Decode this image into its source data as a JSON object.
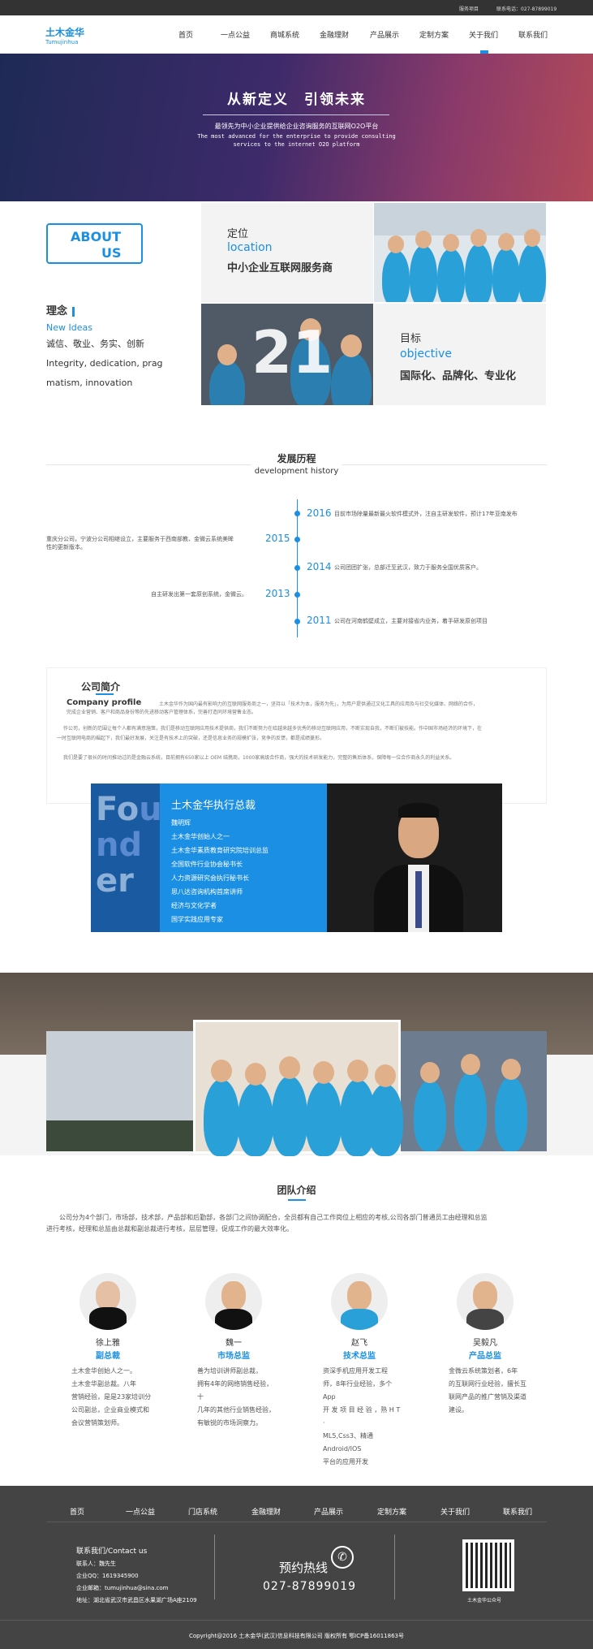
{
  "topbar": {
    "service": "服务项目",
    "phone": "联系电话：027-87899019"
  },
  "brand": {
    "name_cn": "土木金华",
    "name_en": "Tumujinhua"
  },
  "nav": [
    "首页",
    "一点公益",
    "商城系统",
    "金融理财",
    "产品展示",
    "定制方案",
    "关于我们",
    "联系我们"
  ],
  "banner": {
    "title": "从新定义　引领未来",
    "subtitle": "最领先为中小企业提供给企业咨询服务的互联网O2O平台",
    "en_line1": "The most advanced for the enterprise to provide consulting",
    "en_line2": "services to the internet O2O platform"
  },
  "about": {
    "box1": "ABOUT",
    "box2": "US",
    "idea_title": "理念",
    "idea_en": "New Ideas",
    "idea_cn": "诚信、敬业、务实、创新",
    "idea_en1": "Integrity, dedication, prag",
    "idea_en2": "matism, innovation",
    "position_cn": "定位",
    "position_en": "location",
    "position_desc": "中小企业互联网服务商",
    "goal_cn": "目标",
    "goal_en": "objective",
    "goal_desc": "国际化、品牌化、专业化",
    "big_number": "21"
  },
  "history": {
    "title_cn": "发展历程",
    "title_en": "development history",
    "items": [
      {
        "year": "2016",
        "text": "目前市场除量最新最火软件模式外，注自主研发软件，预计17年亚南发布"
      },
      {
        "year": "2015",
        "text1": "重庆分公司，宁波分公司相继设立，主要服务于西南部教、金微云系统美眸",
        "text2": "性的更新版本。"
      },
      {
        "year": "2014",
        "text": "公司团团扩张，总部迁至武汉，致力于服务全国优质客户。"
      },
      {
        "year": "2013",
        "text": "自主研发出第一套原创系统，金微云。"
      },
      {
        "year": "2011",
        "text": "公司在河南鹤壁成立，主要对接省内业务，着手研发原创项目"
      }
    ]
  },
  "company": {
    "title_cn": "公司简介",
    "title_en": "Company profile",
    "p1a": "土木金华作为国内最有影响力的互联网服务商之一，坚持以「技术为本，服务为先」，为用户提供通过文化工具的应用及与社交化媒体、网络的合作，",
    "p1b": "完成企业营销、客户和商品身份等的先进移动客户管理体系，完善打造同环境营售业态。",
    "p2a": "作公司，创新的范围让每个人都有满意施策，我们是移动互联网应用技术提供商，我们不断努力在给越来越多优秀的移动互联网应用，不断实现自我，不断们被技能。作中国市场经济的环境下，在",
    "p2b": "一时互联网电商的崛起下，我们最好发展，关注是有技术上的突破，还是信息业务的规模扩张，竞争的反馈，都是成绩菱形。",
    "p3": "我们是要了很长的时间推动过的是金融云系统，目前拥有650家以上 OEM 结携商，1000家高级合作商，强大的技术研发能力，完整的售后体系，保障每一位合作商永久的利益关系。"
  },
  "founder": {
    "big_letters": [
      "Fo",
      "u",
      "n",
      "d",
      "er"
    ],
    "title": "土木金华执行总裁",
    "lines": [
      "魏明辉",
      "土木金华创始人之一",
      "土木金华素质教育研究院培训总监",
      "全国软件行业协会秘书长",
      "人力资源研究会执行秘书长",
      "思八达咨询机构首席讲师",
      "经济与文化学者",
      "国学实践应用专家"
    ]
  },
  "team": {
    "title": "团队介绍",
    "intro1": "公司分为4个部门，市场部，技术部，产品部和后勤部，各部门之间协调配合，全员都有自己工作岗位上相应的考核,公司各部门普通员工由经理和总监",
    "intro2": "进行考核，经理和总监由总裁和副总裁进行考核，层层管理，促成工作的最大效率化。",
    "members": [
      {
        "name": "徐上雅",
        "role": "副总裁",
        "d1": "土木金华创始人之一。",
        "d2": "土木金华副总裁。八年",
        "d3": "营销经验，是是23家培训分",
        "d4": "公司副总，企业商业模式和",
        "d5": "会议营销策划师。"
      },
      {
        "name": "魏一",
        "role": "市场总监",
        "d1": "善为培训讲师副总裁，",
        "d2": "拥有4年的网络销售经验，十",
        "d3": "几年的其他行业销售经验，",
        "d4": "有敏锐的市场洞察力。",
        "d5": ""
      },
      {
        "name": "赵飞",
        "role": "技术总监",
        "d1": "资深手机应用开发工程",
        "d2": "师，8年行业经验，多个App",
        "d3": "开 发 项 目 经 验 ，熟 H T ·",
        "d4": "ML5,Css3、精通Android/IOS",
        "d5": "平台的应用开发"
      },
      {
        "name": "吴毅凡",
        "role": "产品总监",
        "d1": "金微云系统策划者，6年",
        "d2": "的互联网行业经验，擅长互",
        "d3": "联网产品的推广营销及渠道",
        "d4": "建设。",
        "d5": ""
      }
    ]
  },
  "footer": {
    "nav": [
      "首页",
      "一点公益",
      "门店系统",
      "金融理财",
      "产品展示",
      "定制方案",
      "关于我们",
      "联系我们"
    ],
    "contact_title": "联系我们/Contact us",
    "contact_person": "联系人：魏先生",
    "qq": "企业QQ：1619345900",
    "email": "企业邮箱：tumujinhua@sina.com",
    "address": "地址：湖北省武汉市武昌区水果湖广场A座2109",
    "hotline_label": "预约热线",
    "hotline": "027-87899019",
    "qr_label": "土木金华公众号",
    "copyright": "Copyright@2016 土木金华(武汉)信息科技有限公司 版权所有 鄂ICP备16011863号"
  },
  "colors": {
    "accent": "#1a8fe3",
    "footer": "#444444",
    "topbar": "#333333"
  }
}
